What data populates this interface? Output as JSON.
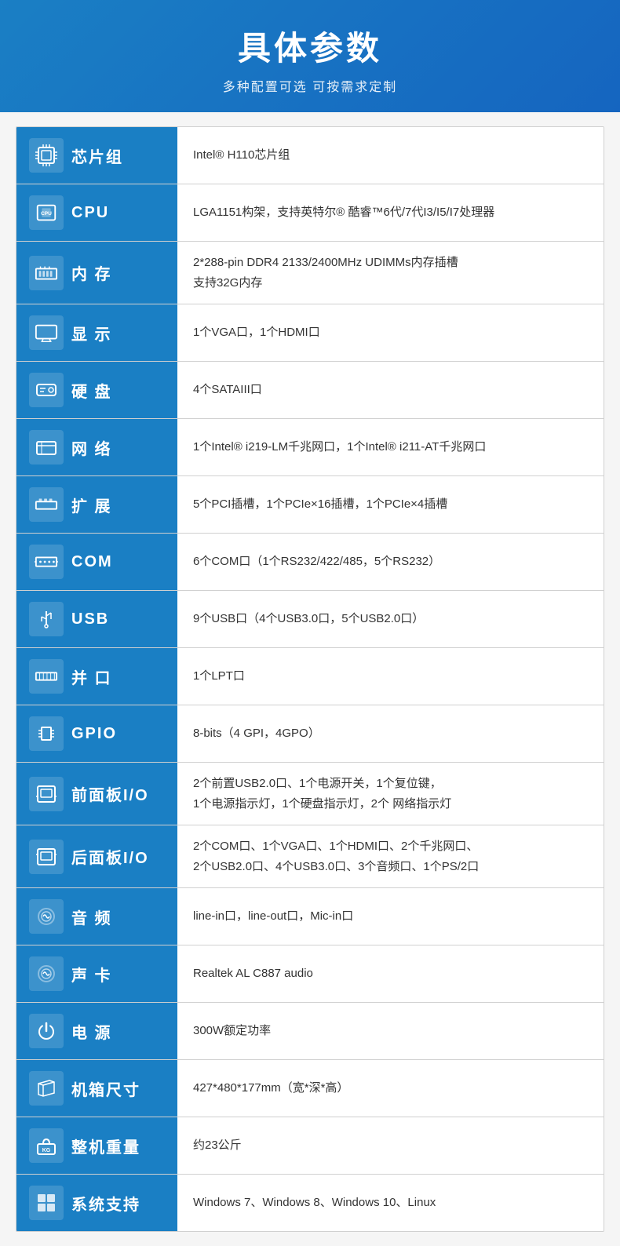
{
  "header": {
    "title": "具体参数",
    "subtitle": "多种配置可选 可按需求定制"
  },
  "rows": [
    {
      "id": "chipset",
      "icon": "⚙",
      "label": "芯片组",
      "value": "Intel® H110芯片组"
    },
    {
      "id": "cpu",
      "icon": "🖥",
      "label": "CPU",
      "value": "LGA1151构架，支持英特尔® 酷睿™6代/7代I3/I5/I7处理器"
    },
    {
      "id": "memory",
      "icon": "▦",
      "label": "内 存",
      "value": "2*288-pin DDR4 2133/2400MHz UDIMMs内存插槽\n支持32G内存"
    },
    {
      "id": "display",
      "icon": "⊟",
      "label": "显 示",
      "value": "1个VGA口，1个HDMI口"
    },
    {
      "id": "hdd",
      "icon": "💾",
      "label": "硬 盘",
      "value": "4个SATAIII口"
    },
    {
      "id": "network",
      "icon": "🌐",
      "label": "网 络",
      "value": "1个Intel® i219-LM千兆网口，1个Intel® i211-AT千兆网口"
    },
    {
      "id": "expansion",
      "icon": "▣",
      "label": "扩 展",
      "value": "5个PCI插槽，1个PCIe×16插槽，1个PCIe×4插槽"
    },
    {
      "id": "com",
      "icon": "⊞",
      "label": "COM",
      "value": "6个COM口（1个RS232/422/485，5个RS232）"
    },
    {
      "id": "usb",
      "icon": "⇅",
      "label": "USB",
      "value": "9个USB口（4个USB3.0口，5个USB2.0口）"
    },
    {
      "id": "parallel",
      "icon": "≡",
      "label": "并 口",
      "value": "1个LPT口"
    },
    {
      "id": "gpio",
      "icon": "⊏",
      "label": "GPIO",
      "value": "8-bits（4 GPI，4GPO）"
    },
    {
      "id": "front-io",
      "icon": "□",
      "label": "前面板I/O",
      "value": "2个前置USB2.0口、1个电源开关，1个复位键，\n1个电源指示灯，1个硬盘指示灯，2个 网络指示灯"
    },
    {
      "id": "rear-io",
      "icon": "□",
      "label": "后面板I/O",
      "value": "2个COM口、1个VGA口、1个HDMI口、2个千兆网口、\n2个USB2.0口、4个USB3.0口、3个音频口、1个PS/2口"
    },
    {
      "id": "audio",
      "icon": "🔊",
      "label": "音 频",
      "value": "line-in口，line-out口，Mic-in口"
    },
    {
      "id": "soundcard",
      "icon": "🔊",
      "label": "声 卡",
      "value": "Realtek AL C887 audio"
    },
    {
      "id": "power",
      "icon": "⚡",
      "label": "电 源",
      "value": "300W额定功率"
    },
    {
      "id": "dimensions",
      "icon": "✂",
      "label": "机箱尺寸",
      "value": "427*480*177mm（宽*深*高）"
    },
    {
      "id": "weight",
      "icon": "⊙",
      "label": "整机重量",
      "value": "约23公斤"
    },
    {
      "id": "os",
      "icon": "⊞",
      "label": "系统支持",
      "value": "Windows 7、Windows 8、Windows 10、Linux"
    }
  ]
}
